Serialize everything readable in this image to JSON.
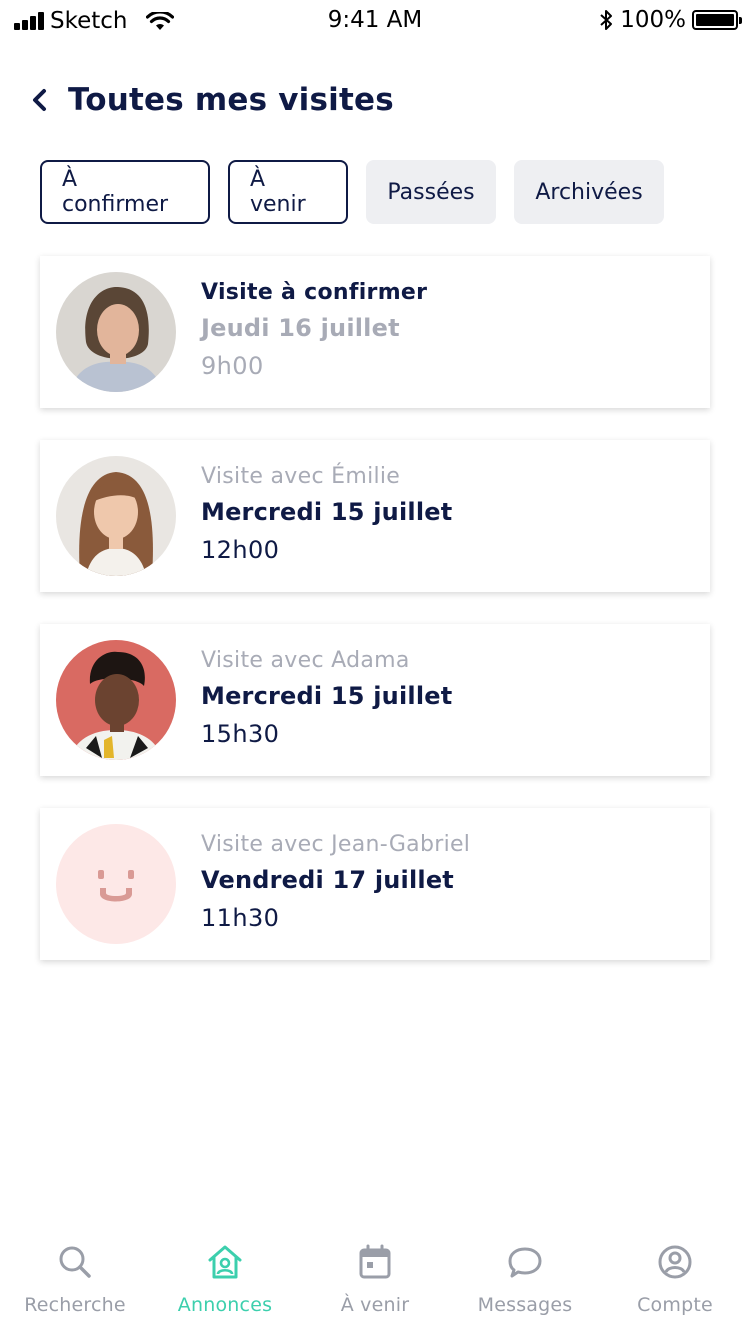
{
  "status_bar": {
    "carrier": "Sketch",
    "time": "9:41 AM",
    "battery": "100%"
  },
  "header": {
    "title": "Toutes mes visites"
  },
  "tabs": [
    {
      "label": "À confirmer",
      "style": "outlined"
    },
    {
      "label": "À venir",
      "style": "outlined"
    },
    {
      "label": "Passées",
      "style": "filled"
    },
    {
      "label": "Archivées",
      "style": "filled"
    }
  ],
  "visits": [
    {
      "line1": "Visite à confirmer",
      "line2": "Jeudi 16 juillet",
      "line3": "9h00",
      "avatar": "woman-photo"
    },
    {
      "line1": "Visite avec Émilie",
      "line2": "Mercredi 15 juillet",
      "line3": "12h00",
      "avatar": "young-woman-photo"
    },
    {
      "line1": "Visite avec Adama",
      "line2": "Mercredi 15 juillet",
      "line3": "15h30",
      "avatar": "man-photo"
    },
    {
      "line1": "Visite avec Jean-Gabriel",
      "line2": "Vendredi 17 juillet",
      "line3": "11h30",
      "avatar": "placeholder-smiley"
    }
  ],
  "bottom_nav": [
    {
      "label": "Recherche",
      "icon": "search-icon",
      "active": false
    },
    {
      "label": "Annonces",
      "icon": "home-user-icon",
      "active": true
    },
    {
      "label": "À venir",
      "icon": "calendar-icon",
      "active": false
    },
    {
      "label": "Messages",
      "icon": "chat-icon",
      "active": false
    },
    {
      "label": "Compte",
      "icon": "account-icon",
      "active": false
    }
  ],
  "colors": {
    "primary": "#0f1a45",
    "muted": "#a8abb6",
    "accent": "#3ccfad",
    "tab_fill": "#eeeff2",
    "placeholder_bg": "#fde8e7",
    "placeholder_face": "#d99a95"
  }
}
